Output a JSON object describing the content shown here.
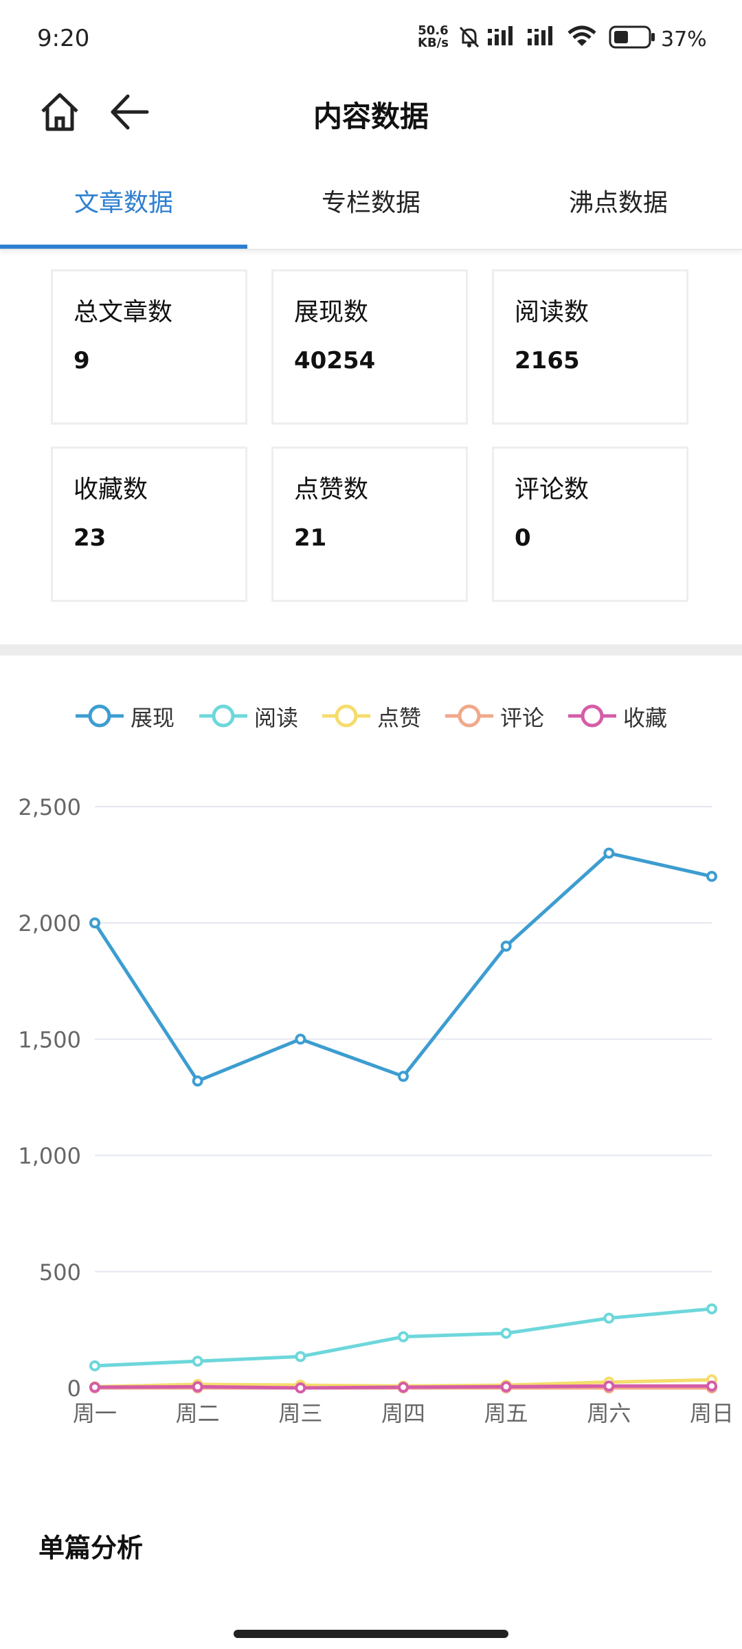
{
  "status_bar": {
    "time": "9:20",
    "net_speed_value": "50.6",
    "net_speed_unit": "KB/s",
    "battery": "37%",
    "icons": [
      "mute-icon",
      "signal-icon",
      "signal-icon",
      "wifi-icon",
      "battery-icon"
    ]
  },
  "header": {
    "title": "内容数据",
    "icons": [
      "home-icon",
      "back-arrow-icon"
    ]
  },
  "tabs": [
    {
      "label": "文章数据",
      "active": true
    },
    {
      "label": "专栏数据",
      "active": false
    },
    {
      "label": "沸点数据",
      "active": false
    }
  ],
  "colors": {
    "accent": "#2f7fd0",
    "series": [
      "#3d9dd0",
      "#6dd7db",
      "#f5dc6c",
      "#f0a88a",
      "#d45da8"
    ]
  },
  "stats": [
    {
      "label": "总文章数",
      "value": "9"
    },
    {
      "label": "展现数",
      "value": "40254"
    },
    {
      "label": "阅读数",
      "value": "2165"
    },
    {
      "label": "收藏数",
      "value": "23"
    },
    {
      "label": "点赞数",
      "value": "21"
    },
    {
      "label": "评论数",
      "value": "0"
    }
  ],
  "chart_data": {
    "type": "line",
    "categories": [
      "周一",
      "周二",
      "周三",
      "周四",
      "周五",
      "周六",
      "周日"
    ],
    "ylim": [
      0,
      2500
    ],
    "yticks": [
      "0",
      "500",
      "1,000",
      "1,500",
      "2,000",
      "2,500"
    ],
    "grid": true,
    "legend_position": "top",
    "series": [
      {
        "name": "展现",
        "values": [
          2000,
          1320,
          1500,
          1340,
          1900,
          2300,
          2200
        ]
      },
      {
        "name": "阅读",
        "values": [
          95,
          115,
          135,
          220,
          235,
          300,
          340
        ]
      },
      {
        "name": "点赞",
        "values": [
          5,
          15,
          12,
          8,
          12,
          25,
          35
        ]
      },
      {
        "name": "评论",
        "values": [
          0,
          0,
          0,
          0,
          0,
          0,
          0
        ]
      },
      {
        "name": "收藏",
        "values": [
          3,
          5,
          0,
          3,
          5,
          8,
          8
        ]
      }
    ]
  },
  "section": {
    "title": "单篇分析"
  }
}
